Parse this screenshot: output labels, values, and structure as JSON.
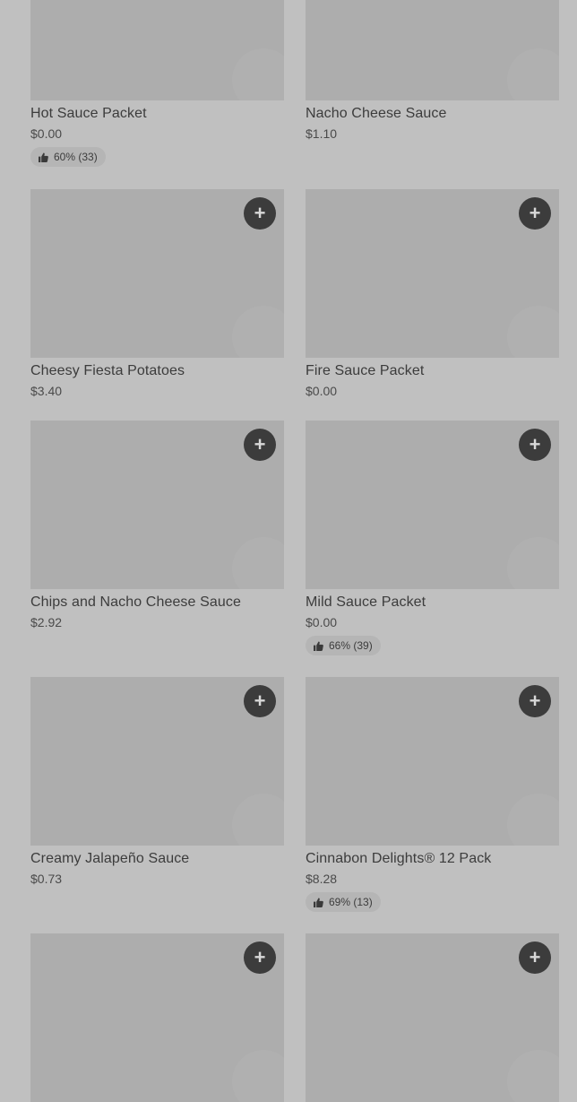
{
  "add_symbol": "+",
  "items": [
    {
      "name": "Hot Sauce Packet",
      "price": "$0.00",
      "rating": "60% (33)"
    },
    {
      "name": "Nacho Cheese Sauce",
      "price": "$1.10"
    },
    {
      "name": "Cheesy Fiesta Potatoes",
      "price": "$3.40"
    },
    {
      "name": "Fire Sauce Packet",
      "price": "$0.00"
    },
    {
      "name": "Chips and Nacho Cheese Sauce",
      "price": "$2.92"
    },
    {
      "name": "Mild Sauce Packet",
      "price": "$0.00",
      "rating": "66% (39)"
    },
    {
      "name": "Creamy Jalapeño Sauce",
      "price": "$0.73"
    },
    {
      "name": "Cinnabon Delights® 12 Pack",
      "price": "$8.28",
      "rating": "69% (13)"
    }
  ]
}
